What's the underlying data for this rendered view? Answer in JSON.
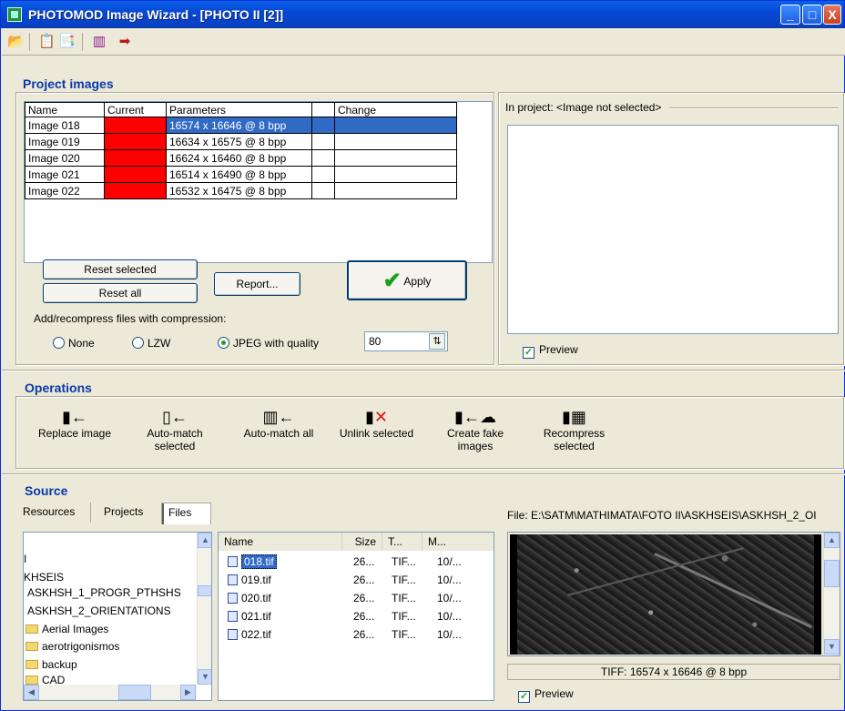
{
  "window": {
    "title": "PHOTOMOD Image Wizard - [PHOTO II [2]]"
  },
  "toolbar": {
    "icons": [
      "open-folder-icon",
      "properties-icon",
      "properties-swap-icon",
      "scale-icon",
      "exit-icon"
    ]
  },
  "project_images": {
    "title": "Project images",
    "columns": [
      "Name",
      "Current",
      "Parameters",
      "",
      "Change"
    ],
    "rows": [
      {
        "name": "Image 018",
        "params": "16574 x 16646 @ 8 bpp"
      },
      {
        "name": "Image 019",
        "params": "16634 x 16575 @ 8 bpp"
      },
      {
        "name": "Image 020",
        "params": "16624 x 16460 @ 8 bpp"
      },
      {
        "name": "Image 021",
        "params": "16514 x 16490 @ 8 bpp"
      },
      {
        "name": "Image 022",
        "params": "16532 x 16475 @ 8 bpp"
      }
    ],
    "reset_selected": "Reset selected",
    "reset_all": "Reset all",
    "report": "Report...",
    "apply": "Apply",
    "compression_label": "Add/recompress files with compression:",
    "opt_none": "None",
    "opt_lzw": "LZW",
    "opt_jpeg": "JPEG with quality",
    "quality": "80",
    "status_color": "#ff0000"
  },
  "right_preview": {
    "label": "In project: <Image not selected>",
    "preview": "Preview"
  },
  "operations": {
    "title": "Operations",
    "replace": "Replace image",
    "automatch_sel_1": "Auto-match",
    "automatch_sel_2": "selected",
    "automatch_all": "Auto-match all",
    "unlink": "Unlink selected",
    "fake_1": "Create fake",
    "fake_2": "images",
    "recompress_1": "Recompress",
    "recompress_2": "selected"
  },
  "source": {
    "title": "Source",
    "tabs": [
      "Resources",
      "Projects",
      "Files"
    ],
    "tree": [
      "I",
      "KHSEIS",
      "ASKHSH_1_PROGR_PTHSHS",
      "ASKHSH_2_ORIENTATIONS",
      "Aerial Images",
      "aerotrigonismos",
      "backup",
      "CAD"
    ],
    "list_columns": [
      "Name",
      "Size",
      "T...",
      "M..."
    ],
    "files": [
      {
        "name": "018.tif",
        "size": "26...",
        "type": "TIF...",
        "mod": "10/..."
      },
      {
        "name": "019.tif",
        "size": "26...",
        "type": "TIF...",
        "mod": "10/..."
      },
      {
        "name": "020.tif",
        "size": "26...",
        "type": "TIF...",
        "mod": "10/..."
      },
      {
        "name": "021.tif",
        "size": "26...",
        "type": "TIF...",
        "mod": "10/..."
      },
      {
        "name": "022.tif",
        "size": "26...",
        "type": "TIF...",
        "mod": "10/..."
      }
    ],
    "file_path": "File: E:\\SATM\\MATHIMATA\\FOTO II\\ASKHSEIS\\ASKHSH_2_OI",
    "image_info": "TIFF: 16574 x 16646 @ 8 bpp",
    "preview": "Preview"
  }
}
